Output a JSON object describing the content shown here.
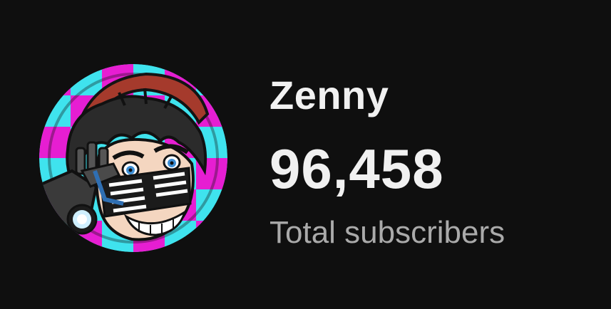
{
  "channel": {
    "name": "Zenny",
    "subscriber_count": "96,458",
    "subscriber_label": "Total subscribers",
    "avatar_icon": "channel-avatar"
  },
  "theme": {
    "background": "#0f0f0f",
    "primary_text": "#f1f1f1",
    "secondary_text": "#aaaaaa",
    "avatar_accent_cyan": "#3fe3ee",
    "avatar_accent_magenta": "#e61ed2"
  }
}
